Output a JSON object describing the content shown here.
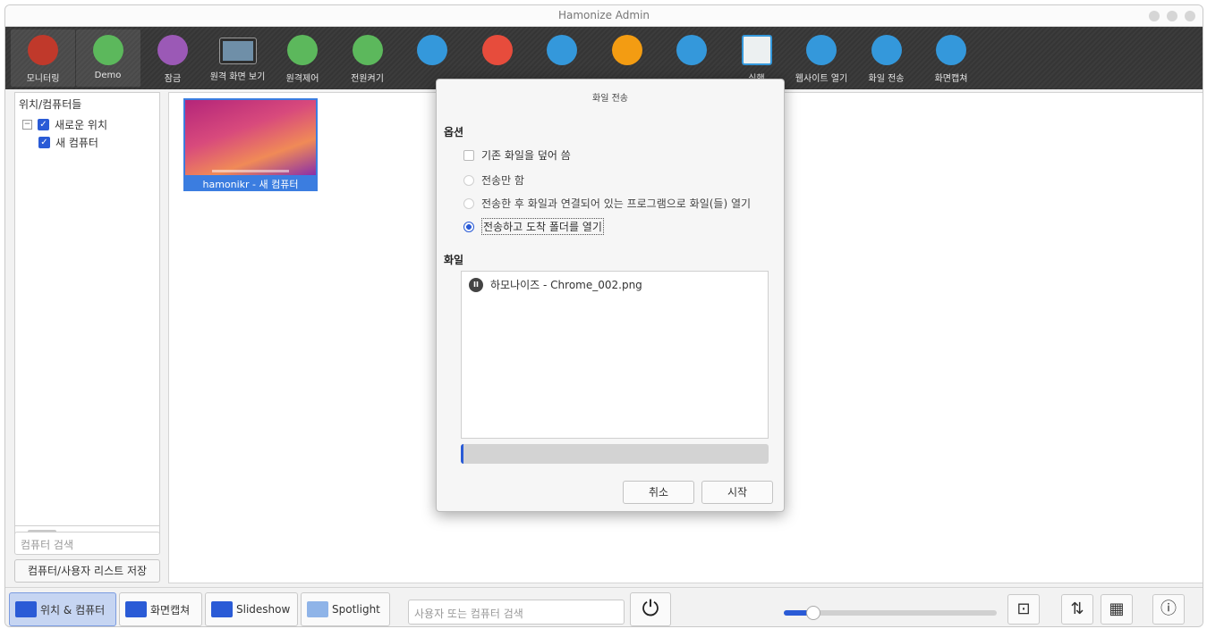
{
  "window": {
    "title": "Hamonize Admin"
  },
  "toolbar": [
    {
      "label": "모니터링",
      "icon": "monitoring-icon",
      "color": "#c0392b",
      "active": true
    },
    {
      "label": "Demo",
      "icon": "presentation-icon",
      "color": "#5cb85c",
      "active": true
    },
    {
      "label": "잠금",
      "icon": "lock-icon",
      "color": "#9b59b6"
    },
    {
      "label": "원격 화면 보기",
      "icon": "remote-view-icon",
      "color": "#6f8fa8"
    },
    {
      "label": "원격제어",
      "icon": "wifi-icon",
      "color": "#5cb85c"
    },
    {
      "label": "전원켜기",
      "icon": "power-on-icon",
      "color": "#5cb85c"
    },
    {
      "label": "",
      "icon": "reboot-icon",
      "color": "#3498db"
    },
    {
      "label": "",
      "icon": "power-off-icon",
      "color": "#e74c3c"
    },
    {
      "label": "",
      "icon": "logout-icon",
      "color": "#3498db"
    },
    {
      "label": "",
      "icon": "login-icon",
      "color": "#f39c12"
    },
    {
      "label": "",
      "icon": "message-icon",
      "color": "#3498db"
    },
    {
      "label": "실행",
      "icon": "run-program-icon",
      "color": "#ecf0f1"
    },
    {
      "label": "웹사이트 열기",
      "icon": "globe-icon",
      "color": "#3498db"
    },
    {
      "label": "화일 전송",
      "icon": "file-transfer-icon",
      "color": "#3498db"
    },
    {
      "label": "화면캡쳐",
      "icon": "screenshot-icon",
      "color": "#3498db"
    }
  ],
  "left": {
    "header": "위치/컴퓨터들",
    "location": "새로운 위치",
    "computer": "새 컴퓨터",
    "search_placeholder": "컴퓨터 검색",
    "save_label": "컴퓨터/사용자 리스트 저장"
  },
  "main": {
    "thumbnail_caption": "hamonikr - 새 컴퓨터"
  },
  "dialog": {
    "title": "화일 전송",
    "options_header": "옵션",
    "overwrite_label": "기존 화일을 덮어 씀",
    "overwrite_checked": false,
    "radio1": "전송만 함",
    "radio2": "전송한 후 화일과 연결되어 있는 프로그램으로 화일(들) 열기",
    "radio3": "전송하고 도착 폴더를 열기",
    "selected_radio": 3,
    "files_header": "화일",
    "file_name": "하모나이즈 - Chrome_002.png",
    "progress_percent": 1,
    "cancel_label": "취소",
    "start_label": "시작"
  },
  "statusbar": {
    "tab1": "위치 & 컴퓨터",
    "tab2": "화면캡쳐",
    "tab3": "Slideshow",
    "tab4": "Spotlight",
    "search_placeholder": "사용자 또는 컴퓨터 검색",
    "zoom_fraction": 0.14
  }
}
